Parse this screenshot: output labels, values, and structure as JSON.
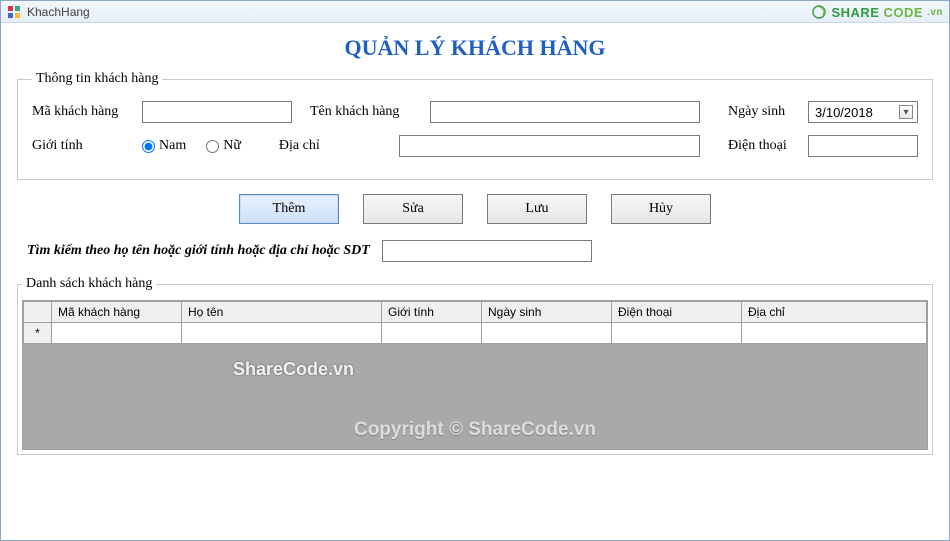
{
  "window": {
    "title": "KhachHang"
  },
  "branding": {
    "share": "SHARE",
    "code": "CODE",
    "vn": ".vn"
  },
  "page": {
    "title": "QUẢN LÝ KHÁCH HÀNG"
  },
  "info": {
    "legend": "Thông tin khách hàng",
    "labels": {
      "id": "Mã khách hàng",
      "name": "Tên khách hàng",
      "dob": "Ngày sinh",
      "gender": "Giới tính",
      "address": "Địa chỉ",
      "phone": "Điện thoại"
    },
    "values": {
      "id": "",
      "name": "",
      "dob": "3/10/2018",
      "address": "",
      "phone": ""
    },
    "gender": {
      "male": "Nam",
      "female": "Nữ",
      "selected": "male"
    }
  },
  "buttons": {
    "add": "Thêm",
    "edit": "Sửa",
    "save": "Lưu",
    "cancel": "Hủy"
  },
  "search": {
    "label": "Tìm kiếm theo họ tên hoặc giới tính hoặc địa chỉ hoặc SDT",
    "value": ""
  },
  "list": {
    "legend": "Danh sách khách hàng",
    "columns": [
      "Mã khách hàng",
      "Họ tên",
      "Giới tính",
      "Ngày sinh",
      "Điện thoại",
      "Địa chỉ"
    ],
    "newRowMarker": "*"
  },
  "watermarks": {
    "line1": "ShareCode.vn",
    "line2": "Copyright © ShareCode.vn"
  }
}
